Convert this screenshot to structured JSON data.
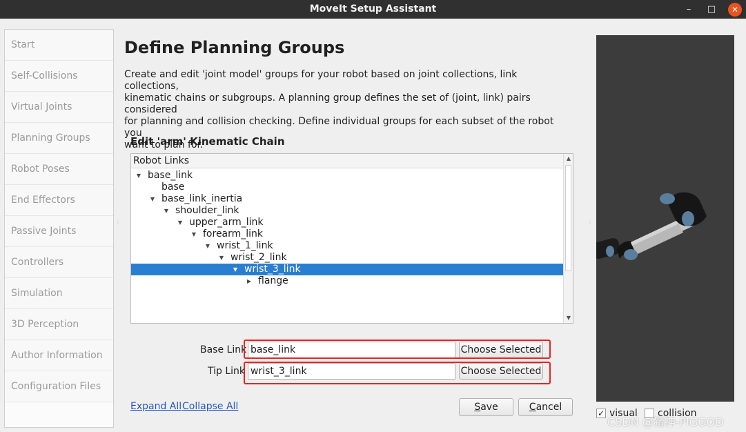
{
  "window": {
    "title": "MoveIt Setup Assistant",
    "controls": {
      "minimize": "–",
      "maximize": "□",
      "close": "✕"
    }
  },
  "sidebar": {
    "items": [
      {
        "label": "Start"
      },
      {
        "label": "Self-Collisions"
      },
      {
        "label": "Virtual Joints"
      },
      {
        "label": "Planning Groups",
        "active": true
      },
      {
        "label": "Robot Poses"
      },
      {
        "label": "End Effectors"
      },
      {
        "label": "Passive Joints"
      },
      {
        "label": "Controllers"
      },
      {
        "label": "Simulation"
      },
      {
        "label": "3D Perception"
      },
      {
        "label": "Author Information"
      },
      {
        "label": "Configuration Files"
      }
    ]
  },
  "main": {
    "title": "Define Planning Groups",
    "description_lines": [
      "Create and edit 'joint model' groups for your robot based on joint collections, link collections,",
      "kinematic chains or subgroups. A planning group defines the set of (joint, link) pairs considered",
      "for planning and collision checking. Define individual groups for each subset of the robot you",
      "want to plan for."
    ],
    "chain_title": "Edit 'arm' Kinematic Chain",
    "tree": {
      "header": "Robot Links",
      "rows": [
        {
          "label": "base_link",
          "depth": 0,
          "arrow": "expanded"
        },
        {
          "label": "base",
          "depth": 1,
          "arrow": "none"
        },
        {
          "label": "base_link_inertia",
          "depth": 1,
          "arrow": "expanded"
        },
        {
          "label": "shoulder_link",
          "depth": 2,
          "arrow": "expanded"
        },
        {
          "label": "upper_arm_link",
          "depth": 3,
          "arrow": "expanded"
        },
        {
          "label": "forearm_link",
          "depth": 4,
          "arrow": "expanded"
        },
        {
          "label": "wrist_1_link",
          "depth": 5,
          "arrow": "expanded"
        },
        {
          "label": "wrist_2_link",
          "depth": 6,
          "arrow": "expanded"
        },
        {
          "label": "wrist_3_link",
          "depth": 7,
          "arrow": "expanded",
          "selected": true
        },
        {
          "label": "flange",
          "depth": 8,
          "arrow": "collapsed"
        }
      ]
    },
    "base_link": {
      "label": "Base Link",
      "value": "base_link",
      "button": "Choose Selected"
    },
    "tip_link": {
      "label": "Tip Link",
      "value": "wrist_3_link",
      "button": "Choose Selected"
    },
    "expand_all": "Expand All",
    "collapse_all": "Collapse All",
    "save_button": "Save",
    "cancel_button": "Cancel"
  },
  "viewer": {
    "visual_label": "visual",
    "visual_checked": true,
    "collision_label": "collision",
    "collision_checked": false,
    "background_color": "#3c3c3c"
  },
  "watermark": "CSDN @猪神-PIGGOD",
  "colors": {
    "selection": "#2a7ed0",
    "highlight_box": "#ee2020",
    "link": "#2456c8",
    "titlebar": "#303030"
  }
}
